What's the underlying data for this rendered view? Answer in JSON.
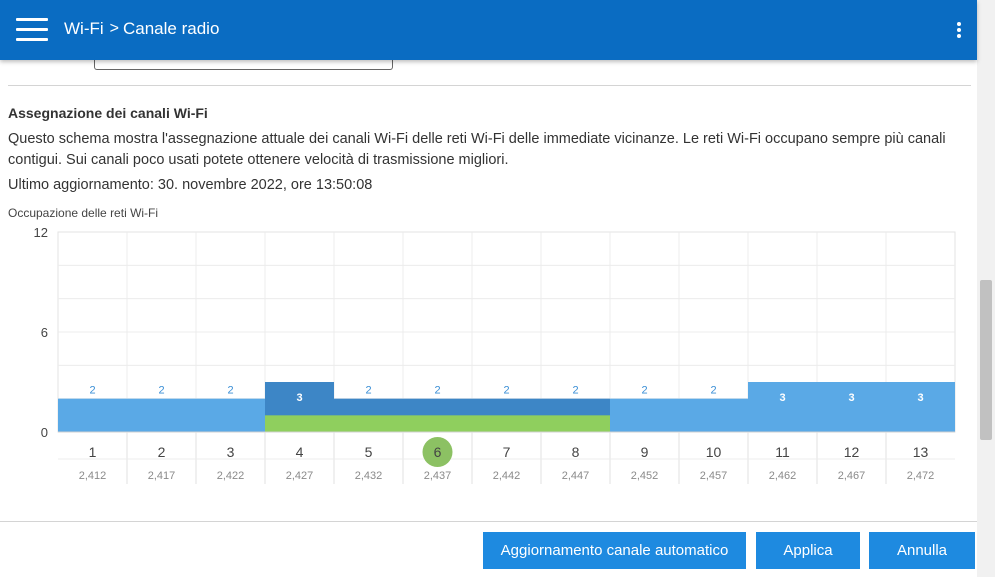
{
  "header": {
    "crumb_parent": "Wi-Fi",
    "crumb_separator": ">",
    "crumb_current": "Canale radio",
    "menu_icon": "hamburger-menu-icon",
    "more_icon": "vertical-dots-icon",
    "background_color": "#0a6cc2"
  },
  "section": {
    "title": "Assegnazione dei canali Wi-Fi",
    "description": "Questo schema mostra l'assegnazione attuale dei canali Wi-Fi delle reti Wi-Fi delle immediate vicinanze. Le reti Wi-Fi occupano sempre più canali contigui. Sui canali poco usati potete ottenere velocità di trasmissione migliori.",
    "last_update": "Ultimo aggiornamento: 30. novembre 2022, ore 13:50:08"
  },
  "chart_data": {
    "type": "bar",
    "title": "Occupazione delle reti Wi-Fi",
    "categories": [
      "1",
      "2",
      "3",
      "4",
      "5",
      "6",
      "7",
      "8",
      "9",
      "10",
      "11",
      "12",
      "13"
    ],
    "frequencies": [
      "2,412",
      "2,417",
      "2,422",
      "2,427",
      "2,432",
      "2,437",
      "2,442",
      "2,447",
      "2,452",
      "2,457",
      "2,462",
      "2,467",
      "2,472"
    ],
    "values": [
      2,
      2,
      2,
      3,
      2,
      2,
      2,
      2,
      2,
      2,
      3,
      3,
      3
    ],
    "own_network_channels": [
      "4",
      "5",
      "6",
      "7",
      "8"
    ],
    "own_network_level": 1,
    "active_channel": "6",
    "ylim": [
      0,
      12
    ],
    "yticks": [
      0,
      6,
      12
    ],
    "grid": true,
    "colors": {
      "bar": "#5aa9e6",
      "bar_overlap": "#3d86c6",
      "own_network": "#8fcf5e",
      "active_channel": "#8cc163"
    }
  },
  "actions": {
    "auto_update_label": "Aggiornamento canale automatico",
    "apply_label": "Applica",
    "cancel_label": "Annulla",
    "button_color": "#1e8ae0"
  }
}
